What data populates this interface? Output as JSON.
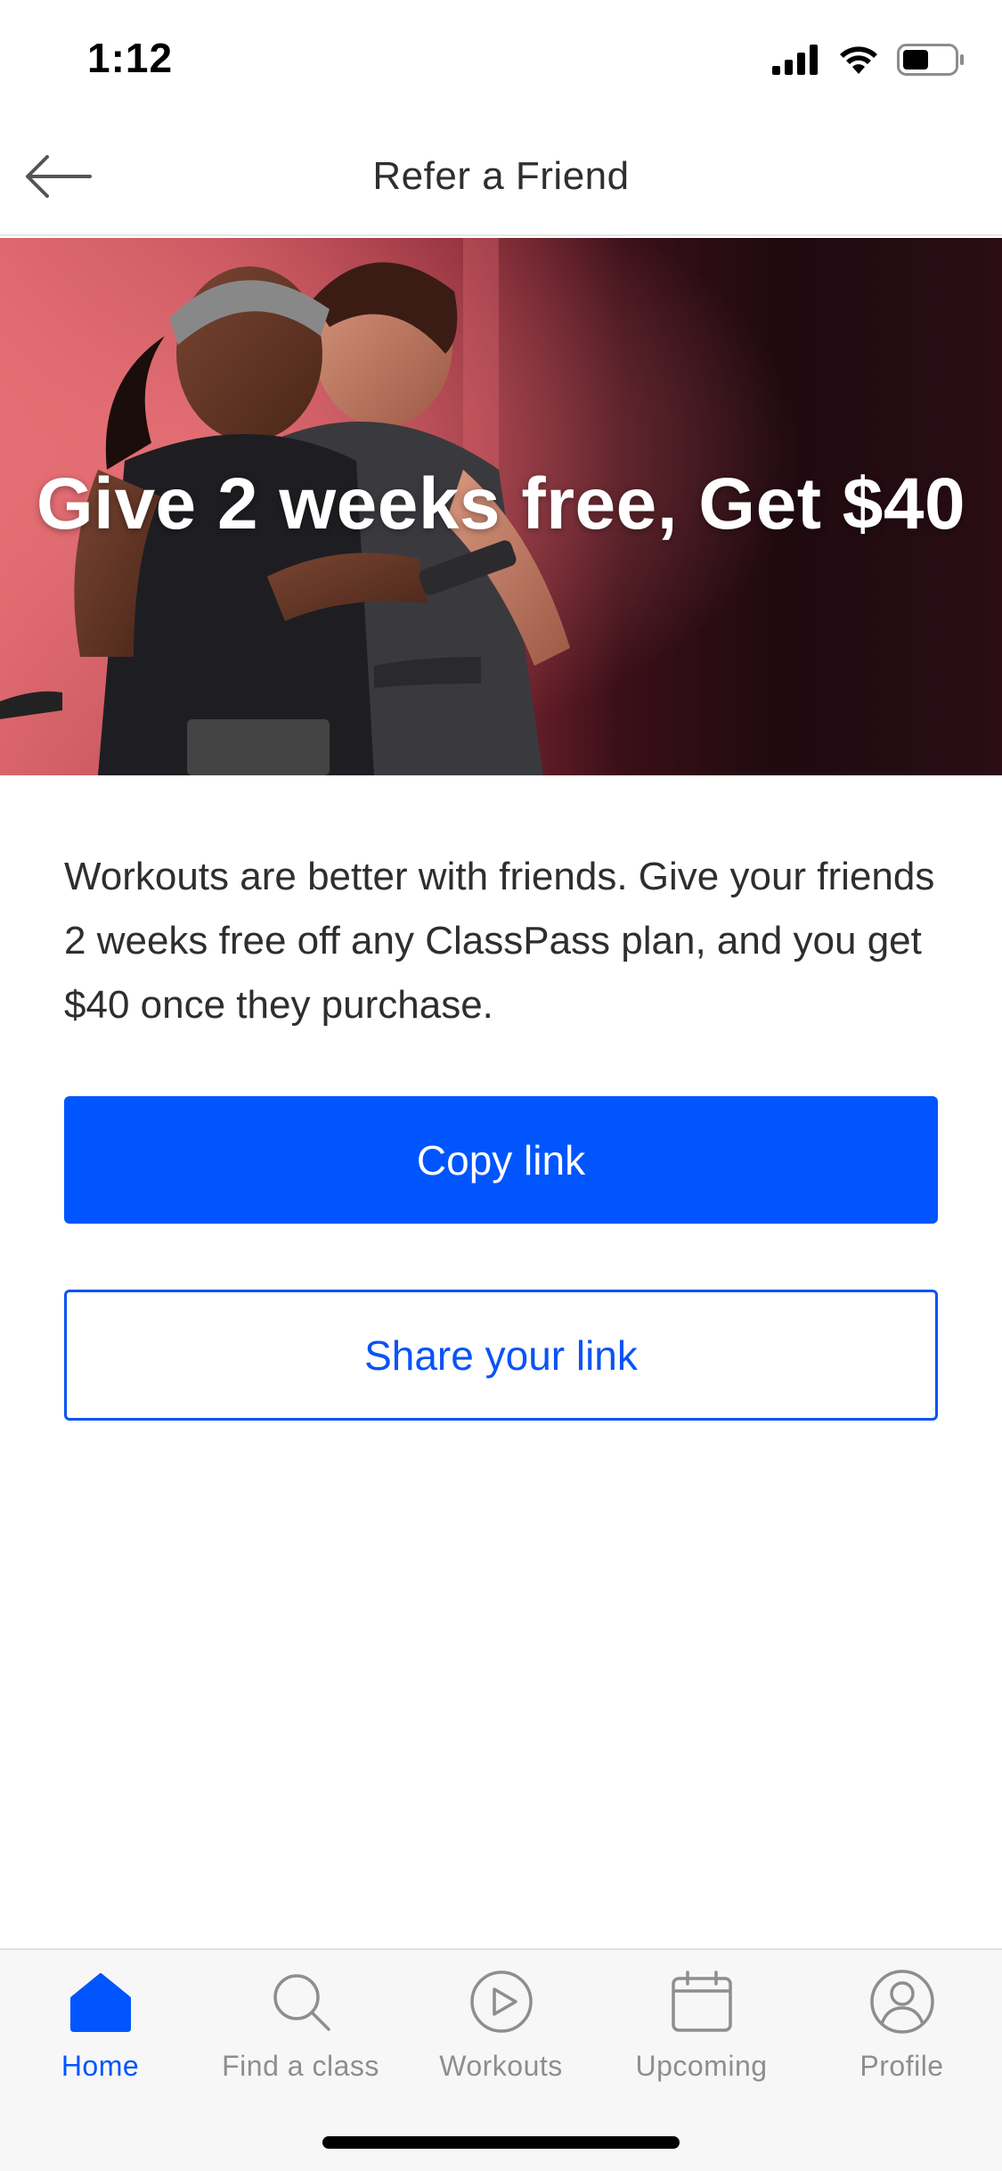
{
  "status_bar": {
    "time": "1:12"
  },
  "nav": {
    "title": "Refer a Friend",
    "back_icon": "arrow-left-icon"
  },
  "hero": {
    "headline": "Give 2 weeks free, Get $40"
  },
  "body": {
    "description": "Workouts are better with friends. Give your friends 2 weeks free off any ClassPass plan, and you get $40 once they purchase."
  },
  "actions": {
    "copy_label": "Copy link",
    "share_label": "Share your link"
  },
  "tabs": [
    {
      "label": "Home",
      "icon": "home-icon",
      "active": true
    },
    {
      "label": "Find a class",
      "icon": "search-icon",
      "active": false
    },
    {
      "label": "Workouts",
      "icon": "play-icon",
      "active": false
    },
    {
      "label": "Upcoming",
      "icon": "calendar-icon",
      "active": false
    },
    {
      "label": "Profile",
      "icon": "profile-icon",
      "active": false
    }
  ],
  "colors": {
    "accent": "#0055ff",
    "tab_inactive": "#8e8e8e"
  }
}
